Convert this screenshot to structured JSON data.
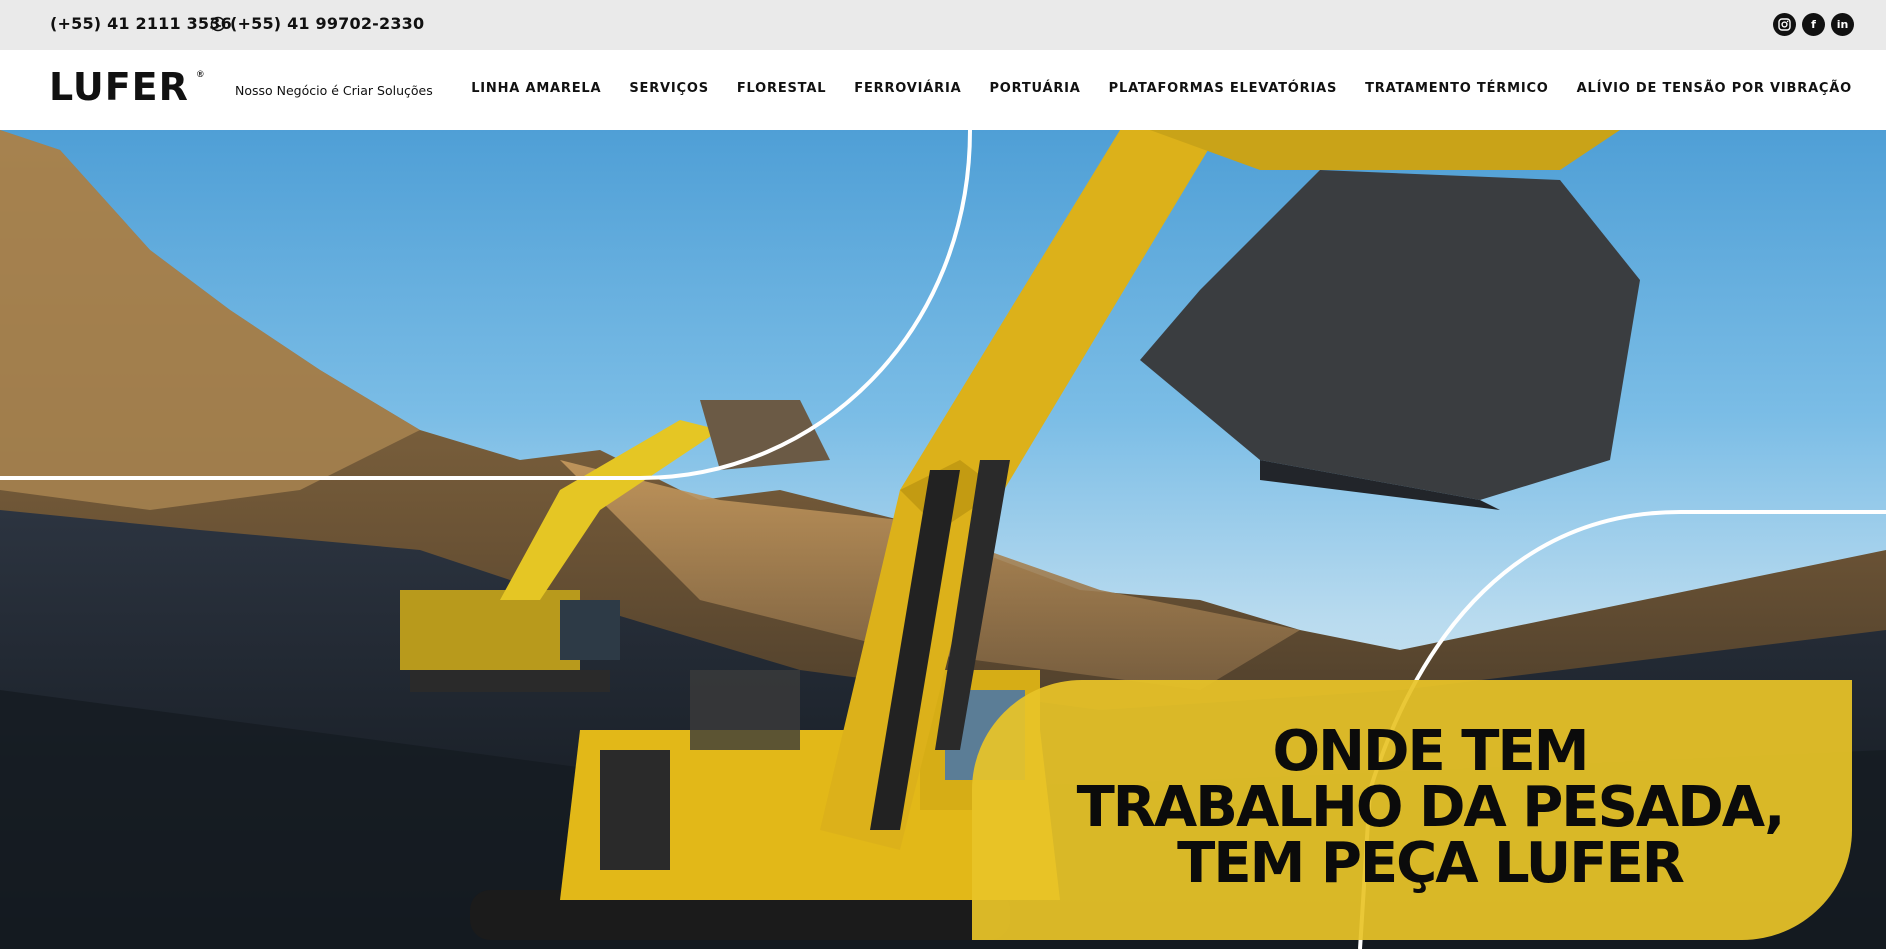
{
  "topbar": {
    "phone": "(+55) 41 2111 3536",
    "whatsapp": "(+55) 41 99702-2330",
    "socials": [
      {
        "name": "instagram-icon",
        "glyph": "◎"
      },
      {
        "name": "facebook-icon",
        "glyph": "f"
      },
      {
        "name": "linkedin-icon",
        "glyph": "in"
      }
    ]
  },
  "header": {
    "logo_text": "LUFER",
    "logo_mark": "®",
    "tagline": "Nosso Negócio é Criar Soluções",
    "nav": [
      "LINHA AMARELA",
      "SERVIÇOS",
      "FLORESTAL",
      "FERROVIÁRIA",
      "PORTUÁRIA",
      "PLATAFORMAS ELEVATÓRIAS",
      "TRATAMENTO TÉRMICO",
      "ALÍVIO DE TENSÃO POR VIBRAÇÃO"
    ]
  },
  "hero": {
    "headline_lines": [
      "ONDE TEM",
      "TRABALHO DA PESADA,",
      "TEM PEÇA LUFER"
    ]
  },
  "colors": {
    "brand_yellow": "#f2c418",
    "headline_box": "#e8c428",
    "topbar_bg": "#eaeaea",
    "text": "#111111"
  }
}
